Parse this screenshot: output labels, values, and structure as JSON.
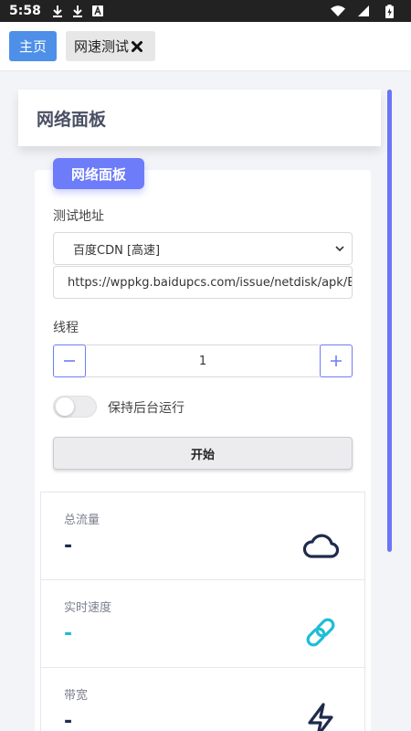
{
  "status_bar": {
    "time": "5:58",
    "icons": [
      "download-icon",
      "download-icon",
      "font-icon",
      "wifi-icon",
      "signal-icon",
      "battery-icon"
    ]
  },
  "tabs": [
    {
      "label": "主页",
      "active": true
    },
    {
      "label": "网速测试",
      "closable": true
    }
  ],
  "panel": {
    "title": "网络面板",
    "badge": "网络面板"
  },
  "form": {
    "url_label": "测试地址",
    "server_select": {
      "selected": "百度CDN [高速]"
    },
    "url_value": "https://wppkg.baidupcs.com/issue/netdisk/apk/Ba",
    "threads_label": "线程",
    "threads_value": "1",
    "background_label": "保持后台运行",
    "background_enabled": false,
    "start_label": "开始"
  },
  "stats": [
    {
      "label": "总流量",
      "value": "-",
      "icon": "cloud-icon",
      "color": "#1f2b4d"
    },
    {
      "label": "实时速度",
      "value": "-",
      "icon": "link-icon",
      "color": "#1fbdd6"
    },
    {
      "label": "带宽",
      "value": "-",
      "icon": "bolt-icon",
      "color": "#1f2b4d"
    }
  ],
  "colors": {
    "accent": "#6d7cf8",
    "home_tab": "#4e8fe8",
    "link_color": "#1fbdd6",
    "dark_icon": "#1f2b4d"
  }
}
